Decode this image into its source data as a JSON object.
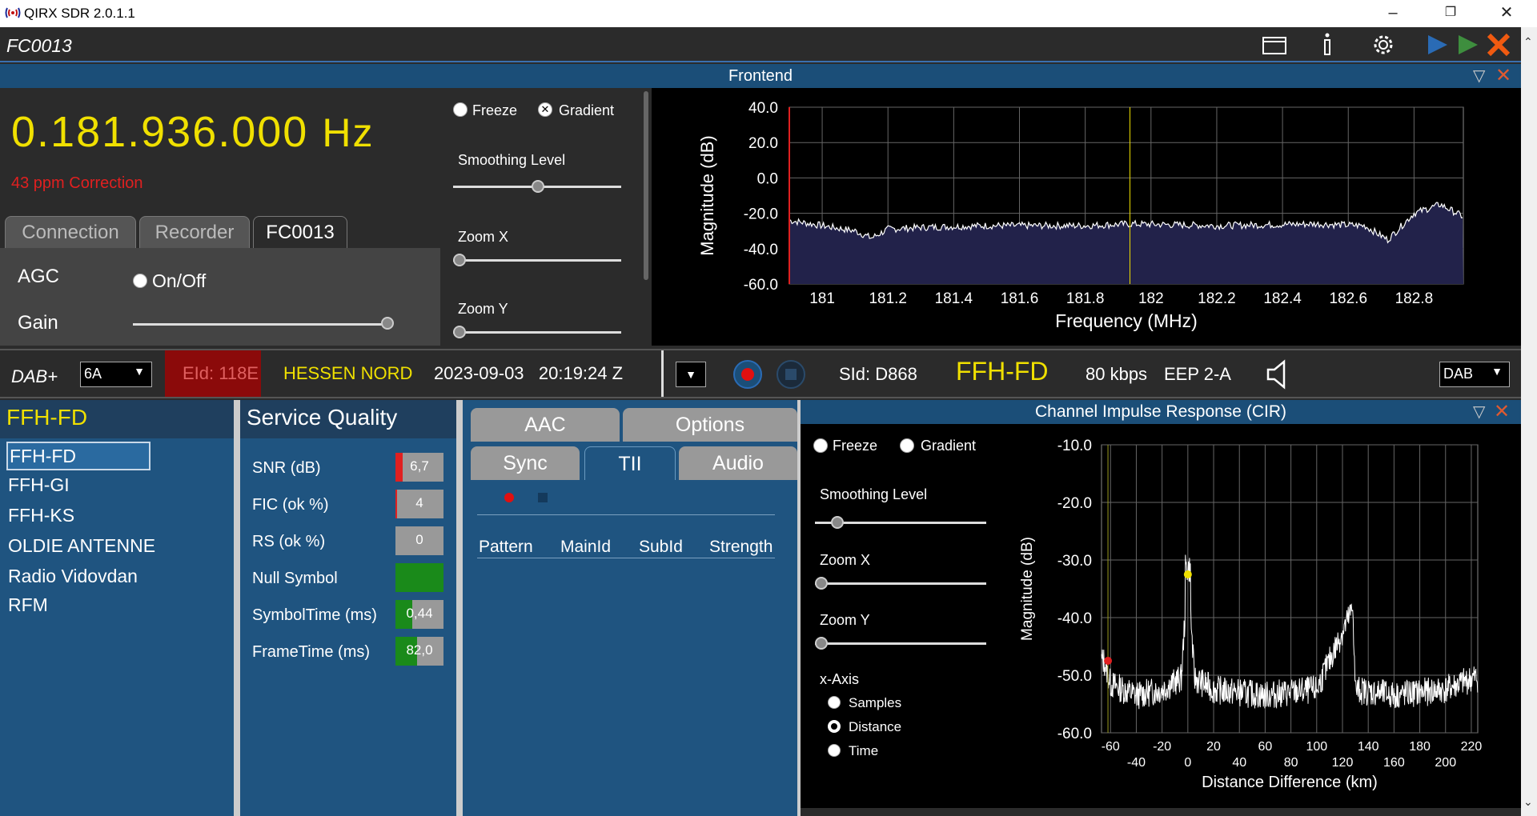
{
  "window": {
    "title": "QIRX SDR 2.0.1.1"
  },
  "toolbar": {
    "device_name": "FC0013"
  },
  "frontend": {
    "header": "Frontend",
    "frequency": "0.181.936.000",
    "frequency_unit": "Hz",
    "ppm": "43 ppm Correction",
    "tabs": [
      "Connection",
      "Recorder",
      "FC0013"
    ],
    "agc_label": "AGC",
    "agc_onoff": "On/Off",
    "gain_label": "Gain",
    "freeze": "Freeze",
    "gradient": "Gradient",
    "smoothing": "Smoothing Level",
    "zoom_x": "Zoom X",
    "zoom_y": "Zoom Y"
  },
  "chart_data": [
    {
      "type": "line",
      "xlabel": "Frequency (MHz)",
      "ylabel": "Magnitude (dB)",
      "xlim": [
        180.9,
        182.95
      ],
      "ylim": [
        -60,
        40
      ],
      "xticks": [
        "181",
        "181.2",
        "181.4",
        "181.6",
        "181.8",
        "182",
        "182.2",
        "182.4",
        "182.6",
        "182.8"
      ],
      "yticks": [
        "40.0",
        "20.0",
        "0.0",
        "-20.0",
        "-40.0",
        "-60.0"
      ],
      "x": [
        180.9,
        181.0,
        181.1,
        181.15,
        181.2,
        181.3,
        181.5,
        181.8,
        181.94,
        182.2,
        182.5,
        182.65,
        182.72,
        182.8,
        182.88,
        182.95
      ],
      "y": [
        -24,
        -27,
        -30,
        -34,
        -29,
        -28,
        -27,
        -27,
        -26,
        -27,
        -26,
        -27,
        -35,
        -20,
        -15,
        -22
      ]
    },
    {
      "type": "line",
      "xlabel": "Distance Difference (km)",
      "ylabel": "Magnitude (dB)",
      "xlim": [
        -67,
        225
      ],
      "ylim": [
        -60,
        -10
      ],
      "xticks": [
        "-60",
        "-40",
        "-20",
        "0",
        "20",
        "40",
        "60",
        "80",
        "100",
        "120",
        "140",
        "160",
        "180",
        "200",
        "220"
      ],
      "yticks": [
        "-10.0",
        "-20.0",
        "-30.0",
        "-40.0",
        "-50.0",
        "-60.0"
      ],
      "x": [
        -65,
        -60,
        -40,
        -20,
        -5,
        0,
        5,
        20,
        60,
        100,
        128,
        130,
        160,
        200,
        222
      ],
      "y": [
        -49,
        -53,
        -55,
        -54,
        -52,
        -32.5,
        -52,
        -54,
        -55,
        -54,
        -40,
        -54,
        -55,
        -54,
        -52
      ],
      "peak_markers": [
        {
          "x": -62,
          "y": -47.5,
          "color": "#e02020"
        },
        {
          "x": 0,
          "y": -32.5,
          "color": "#f0e000"
        }
      ]
    }
  ],
  "dab": {
    "label": "DAB+",
    "channel": "6A",
    "eid": "EId: 118E",
    "ensemble": "HESSEN NORD",
    "datetime": "2023-09-03   20:19:24 Z",
    "sid": "SId: D868",
    "service": "FFH-FD",
    "bitrate": "80 kbps",
    "eep": "EEP 2-A",
    "mode": "DAB"
  },
  "services": {
    "header": "FFH-FD",
    "items": [
      "FFH-FD",
      "FFH-GI",
      "FFH-KS",
      "OLDIE ANTENNE",
      "Radio Vidovdan",
      "RFM"
    ]
  },
  "quality": {
    "header": "Service Quality",
    "rows": [
      {
        "label": "SNR (dB)",
        "value": "6,7",
        "fill": 0.15,
        "color": "#e02020"
      },
      {
        "label": "FIC (ok %)",
        "value": "4",
        "fill": 0.04,
        "color": "#e02020"
      },
      {
        "label": "RS (ok %)",
        "value": "0",
        "fill": 0,
        "color": "#e02020"
      },
      {
        "label": "Null Symbol",
        "value": "",
        "fill": 1.0,
        "color": "#1a8a1a"
      },
      {
        "label": "SymbolTime (ms)",
        "value": "0,44",
        "fill": 0.35,
        "color": "#1a8a1a"
      },
      {
        "label": "FrameTime (ms)",
        "value": "82,0",
        "fill": 0.45,
        "color": "#1a8a1a"
      }
    ]
  },
  "tabs2": {
    "row1": [
      "AAC",
      "Options"
    ],
    "row2": [
      "Sync",
      "TII",
      "Audio"
    ],
    "columns": [
      "Pattern",
      "MainId",
      "SubId",
      "Strength"
    ]
  },
  "cir": {
    "header": "Channel Impulse Response (CIR)",
    "freeze": "Freeze",
    "gradient": "Gradient",
    "smoothing": "Smoothing Level",
    "zoom_x": "Zoom X",
    "zoom_y": "Zoom Y",
    "xaxis_label": "x-Axis",
    "xaxis_options": [
      "Samples",
      "Distance",
      "Time"
    ]
  }
}
